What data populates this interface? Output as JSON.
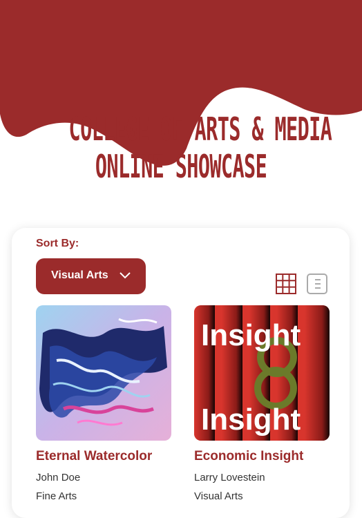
{
  "header": {
    "title_line1": "College of Arts & Media",
    "title_line2": "Online Showcase",
    "brand_color": "#9b2b2b"
  },
  "controls": {
    "sort_label": "Sort By:",
    "sort_value": "Visual Arts",
    "view_grid_icon": "grid-icon",
    "view_list_icon": "list-icon"
  },
  "projects": [
    {
      "title": "Eternal Watercolor",
      "author": "John Doe",
      "category": "Fine Arts"
    },
    {
      "title": "Economic Insight",
      "author": "Larry Lovestein",
      "category": "Visual Arts"
    }
  ],
  "artwork": {
    "poster_word": "Insight"
  }
}
